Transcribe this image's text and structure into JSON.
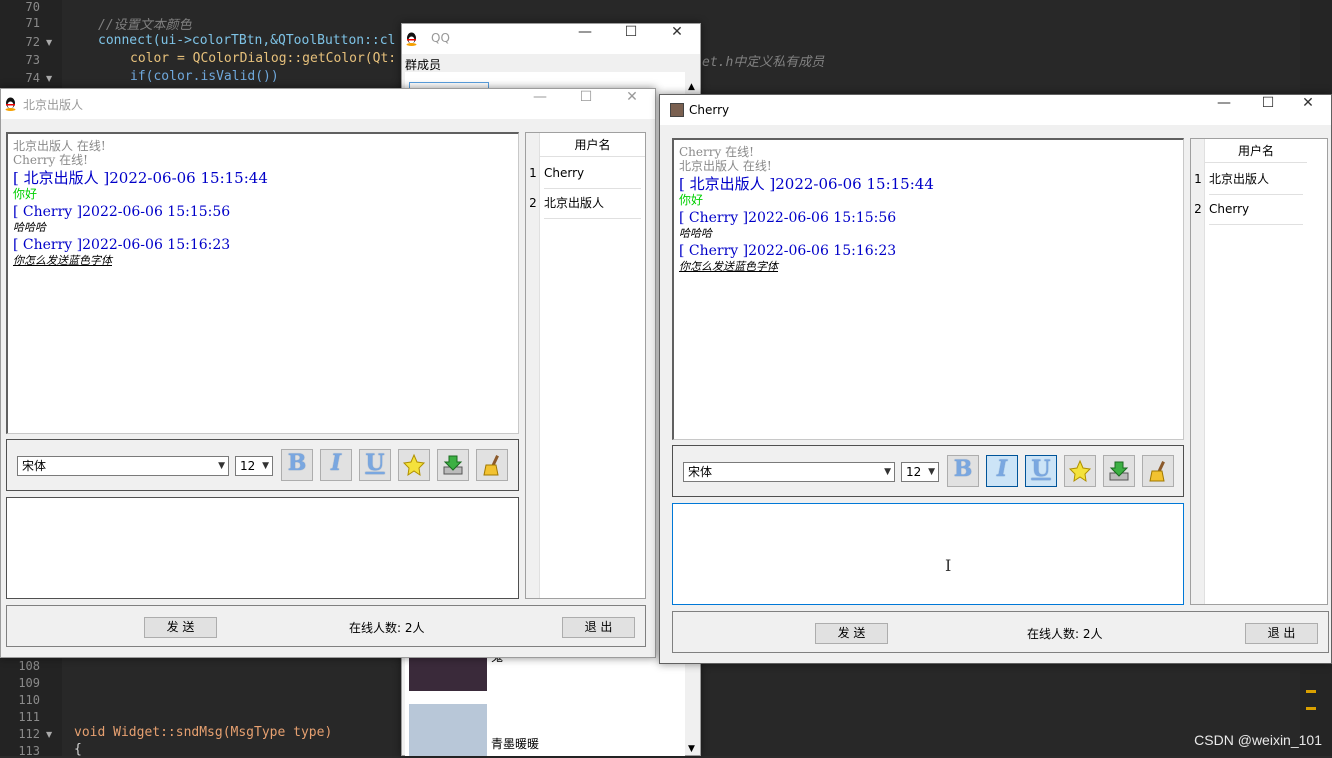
{
  "editor": {
    "lines": [
      {
        "n": "70",
        "text": ""
      },
      {
        "n": "71",
        "text": "//设置文本颜色"
      },
      {
        "n": "72",
        "text": "connect(ui->colorTBtn,&QToolButton::cl"
      },
      {
        "n": "73",
        "text": "color = QColorDialog::getColor(Qt:"
      },
      {
        "n": "74",
        "text": "if(color.isValid())"
      },
      {
        "n": "108",
        "text": ""
      },
      {
        "n": "109",
        "text": ""
      },
      {
        "n": "110",
        "text": ""
      },
      {
        "n": "111",
        "text": ""
      },
      {
        "n": "112",
        "text": "void Widget::sndMsg(MsgType type)"
      },
      {
        "n": "113",
        "text": "{"
      }
    ],
    "line73_tail": "et.h中定义私有成员"
  },
  "qq_window": {
    "title": "QQ",
    "members_label": "群成员",
    "member_label_partial": "鬼",
    "member_bottom": "青墨暖暖",
    "colors": {
      "avatar1": "#3a2a3a",
      "avatar2": "#b8c7d8"
    }
  },
  "windows": [
    {
      "id": "beijing",
      "title": "北京出版人",
      "messages": [
        {
          "type": "sys",
          "text": "北京出版人 在线!"
        },
        {
          "type": "sys",
          "text": "Cherry 在线!"
        },
        {
          "type": "hdr",
          "text": "[ 北京出版人 ]2022-06-06 15:15:44"
        },
        {
          "type": "green",
          "text": "你好"
        },
        {
          "type": "hdr",
          "text": "[ Cherry ]2022-06-06 15:15:56"
        },
        {
          "type": "it",
          "text": "哈哈哈"
        },
        {
          "type": "hdr",
          "text": "[ Cherry ]2022-06-06 15:16:23"
        },
        {
          "type": "iu",
          "text": "你怎么发送蓝色字体"
        }
      ],
      "font_combo": "宋体",
      "size_combo": "12",
      "user_header": "用户名",
      "users": [
        {
          "n": "1",
          "name": "Cherry"
        },
        {
          "n": "2",
          "name": "北京出版人"
        }
      ],
      "send_label": "发 送",
      "count_label": "在线人数: 2人",
      "exit_label": "退 出"
    },
    {
      "id": "cherry",
      "title": "Cherry",
      "messages": [
        {
          "type": "sys",
          "text": "Cherry 在线!"
        },
        {
          "type": "sys",
          "text": "北京出版人 在线!"
        },
        {
          "type": "hdr",
          "text": "[ 北京出版人 ]2022-06-06 15:15:44"
        },
        {
          "type": "green",
          "text": "你好"
        },
        {
          "type": "hdr",
          "text": "[ Cherry ]2022-06-06 15:15:56"
        },
        {
          "type": "it",
          "text": "哈哈哈"
        },
        {
          "type": "hdr",
          "text": "[ Cherry ]2022-06-06 15:16:23"
        },
        {
          "type": "iu",
          "text": "你怎么发送蓝色字体"
        }
      ],
      "font_combo": "宋体",
      "size_combo": "12",
      "user_header": "用户名",
      "users": [
        {
          "n": "1",
          "name": "北京出版人"
        },
        {
          "n": "2",
          "name": "Cherry"
        }
      ],
      "send_label": "发 送",
      "count_label": "在线人数: 2人",
      "exit_label": "退 出"
    }
  ],
  "toolbar_glyphs": {
    "bold": "B",
    "italic": "I",
    "underline": "U"
  },
  "titlebar_glyphs": {
    "min": "—",
    "max": "☐",
    "close": "✕"
  },
  "watermark": "CSDN @weixin_101"
}
